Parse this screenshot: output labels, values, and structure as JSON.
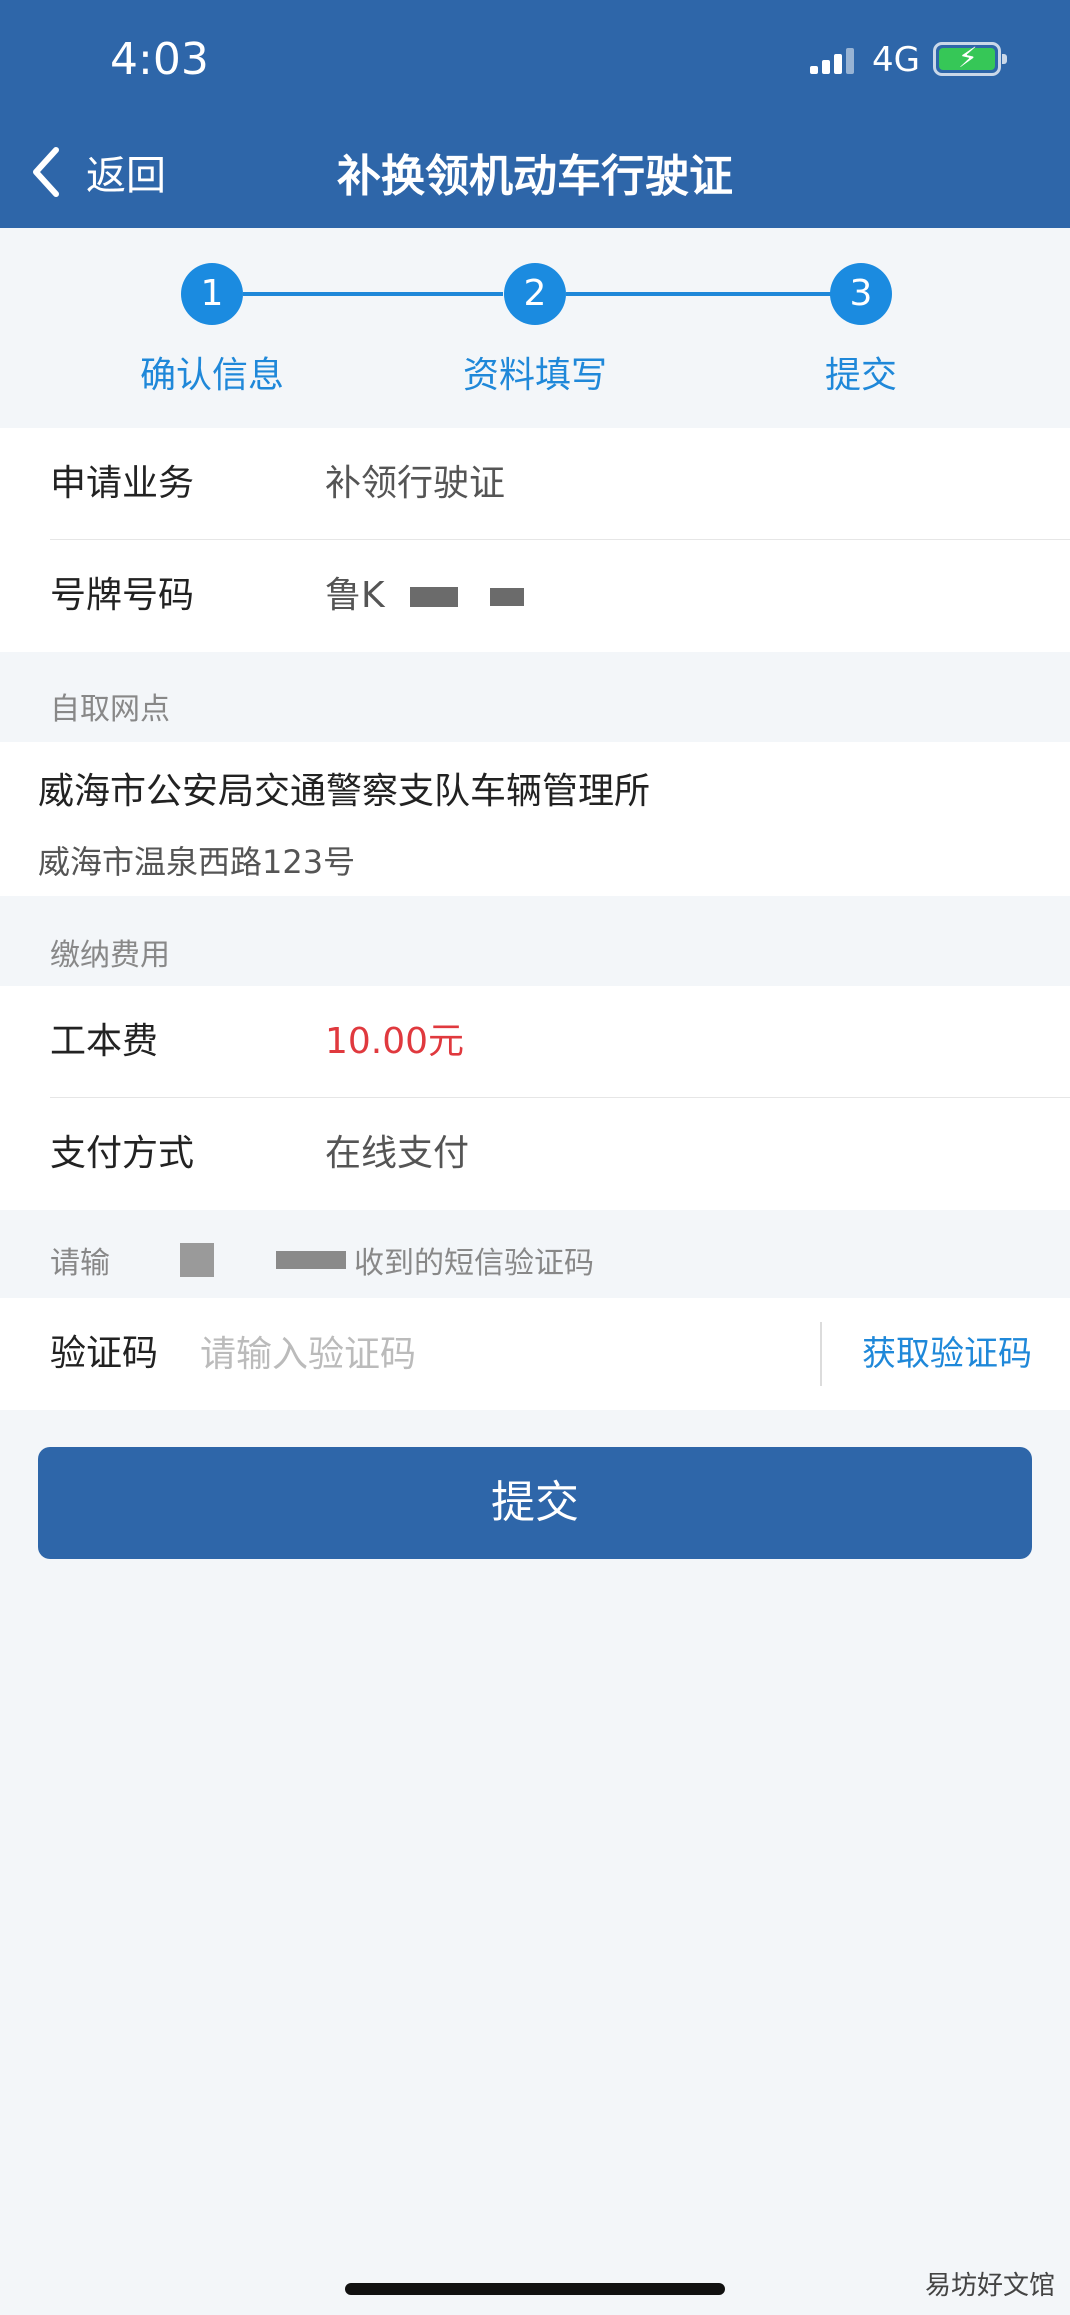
{
  "status_bar": {
    "time": "4:03",
    "network": "4G"
  },
  "nav": {
    "back_label": "返回",
    "title": "补换领机动车行驶证"
  },
  "steps": [
    {
      "number": "1",
      "label": "确认信息"
    },
    {
      "number": "2",
      "label": "资料填写"
    },
    {
      "number": "3",
      "label": "提交"
    }
  ],
  "info": {
    "business_label": "申请业务",
    "business_value": "补领行驶证",
    "plate_label": "号牌号码",
    "plate_value": "鲁K"
  },
  "pickup": {
    "section_label": "自取网点",
    "name": "威海市公安局交通警察支队车辆管理所",
    "address": "威海市温泉西路123号"
  },
  "fees": {
    "section_label": "缴纳费用",
    "fee_label": "工本费",
    "fee_value": "10.00元",
    "payment_label": "支付方式",
    "payment_value": "在线支付"
  },
  "sms": {
    "hint_prefix": "请输",
    "hint_suffix": "收到的短信验证码",
    "code_label": "验证码",
    "code_placeholder": "请输入验证码",
    "get_code_label": "获取验证码"
  },
  "submit_label": "提交",
  "watermark": "易坊好文馆"
}
